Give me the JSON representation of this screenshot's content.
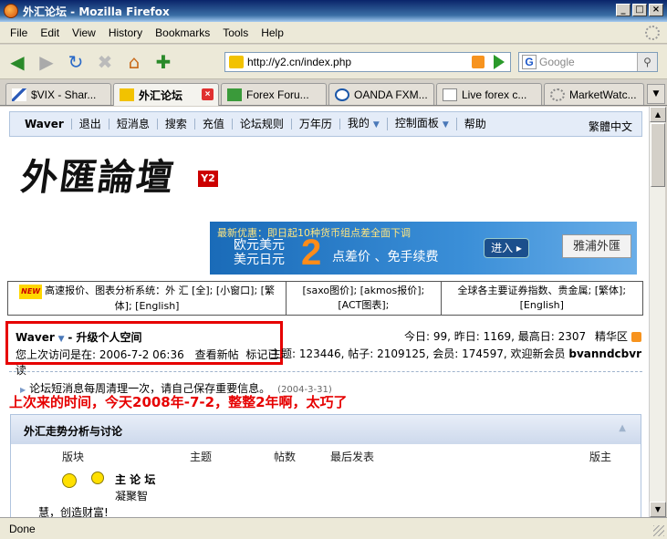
{
  "window": {
    "title": "外汇论坛 - Mozilla Firefox",
    "buttons": [
      "_",
      "□",
      "×"
    ]
  },
  "menu": [
    "File",
    "Edit",
    "View",
    "History",
    "Bookmarks",
    "Tools",
    "Help"
  ],
  "nav": {
    "url": "http://y2.cn/index.php",
    "search_placeholder": "Google",
    "search_engine_letter": "G"
  },
  "tabs": [
    {
      "label": "$VIX - Shar...",
      "active": false
    },
    {
      "label": "外汇论坛",
      "active": true
    },
    {
      "label": "Forex Foru...",
      "active": false
    },
    {
      "label": "OANDA FXM...",
      "active": false
    },
    {
      "label": "Live forex c...",
      "active": false
    },
    {
      "label": "MarketWatc...",
      "active": false
    }
  ],
  "site_nav": {
    "user": "Waver",
    "items": [
      "退出",
      "短消息",
      "搜索",
      "充值",
      "论坛规则",
      "万年历",
      "我的",
      "控制面板",
      "帮助"
    ],
    "traditional": "繁體中文"
  },
  "logo": {
    "text": "外匯論壇",
    "badge": "Y2"
  },
  "banner": {
    "line1": "最新优惠：即日起10种货币组点差全面下调",
    "line2a": "欧元美元",
    "line2b": "美元日元",
    "big": "2",
    "line3": "点差价 、免手续费",
    "enter": "进入 ▸",
    "brand": "雅浦外匯"
  },
  "quotes": {
    "new_badge": "NEW",
    "cell1": "高速报价、图表分析系统：外 汇 [全]; [小窗口]; [繁体]; [English]",
    "cell2": "[saxo图价]; [akmos报价]; [ACT图表];",
    "cell3": "全球各主要证券指数、贵金属; [繁体]; [English]"
  },
  "user_panel": {
    "name": "Waver",
    "upgrade": "- 升级个人空间",
    "last_visit_label": "您上次访问是在: 2006-7-2 06:36",
    "view_new": "查看新帖",
    "mark_read": "标记已读"
  },
  "stats": {
    "line1": "今日: 99, 昨日: 1169, 最高日: 2307",
    "digest": "精华区",
    "line2": "主题: 123446, 帖子: 2109125, 会员: 174597, 欢迎新会员",
    "newest_member": "bvanndcbvr"
  },
  "notice": {
    "text": "论坛短消息每周清理一次，请自己保存重要信息。",
    "date": "(2004-3-31)"
  },
  "annotation": "上次来的时间，今天2008年-7-2，整整2年啊，太巧了",
  "forum_section": {
    "title": "外汇走势分析与讨论",
    "columns": [
      "版块",
      "主题",
      "帖数",
      "最后发表",
      "版主"
    ],
    "forum_name": "主 论 坛",
    "forum_desc": "凝聚智",
    "forum_desc2": "慧，创造财富!"
  },
  "status": "Done"
}
